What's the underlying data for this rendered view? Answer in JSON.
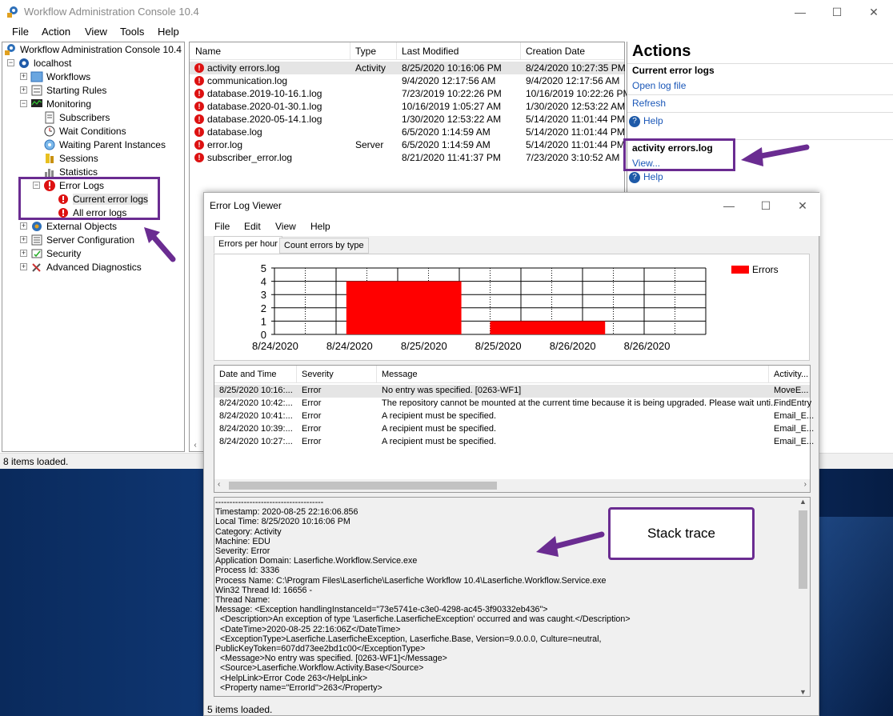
{
  "window": {
    "title": "Workflow Administration Console 10.4",
    "minimize": "—",
    "maximize": "☐",
    "close": "✕"
  },
  "menu": [
    "File",
    "Action",
    "View",
    "Tools",
    "Help"
  ],
  "tree": {
    "root": "Workflow Administration Console 10.4",
    "server": "localhost",
    "items": {
      "workflows": "Workflows",
      "starting_rules": "Starting Rules",
      "monitoring": "Monitoring",
      "subscribers": "Subscribers",
      "wait_conditions": "Wait Conditions",
      "waiting_parent": "Waiting Parent Instances",
      "sessions": "Sessions",
      "statistics": "Statistics",
      "error_logs": "Error Logs",
      "current_error_logs": "Current error logs",
      "all_error_logs": "All error logs",
      "external_objects": "External Objects",
      "server_configuration": "Server Configuration",
      "security": "Security",
      "advanced_diagnostics": "Advanced Diagnostics"
    }
  },
  "list": {
    "columns": [
      "Name",
      "Type",
      "Last Modified",
      "Creation Date"
    ],
    "rows": [
      {
        "name": "activity errors.log",
        "type": "Activity",
        "modified": "8/25/2020 10:16:06 PM",
        "created": "8/24/2020 10:27:35 PM"
      },
      {
        "name": "communication.log",
        "type": "",
        "modified": "9/4/2020 12:17:56 AM",
        "created": "9/4/2020 12:17:56 AM"
      },
      {
        "name": "database.2019-10-16.1.log",
        "type": "",
        "modified": "7/23/2019 10:22:26 PM",
        "created": "10/16/2019 10:22:26 PM"
      },
      {
        "name": "database.2020-01-30.1.log",
        "type": "",
        "modified": "10/16/2019 1:05:27 AM",
        "created": "1/30/2020 12:53:22 AM"
      },
      {
        "name": "database.2020-05-14.1.log",
        "type": "",
        "modified": "1/30/2020 12:53:22 AM",
        "created": "5/14/2020 11:01:44 PM"
      },
      {
        "name": "database.log",
        "type": "",
        "modified": "6/5/2020 1:14:59 AM",
        "created": "5/14/2020 11:01:44 PM"
      },
      {
        "name": "error.log",
        "type": "Server",
        "modified": "6/5/2020 1:14:59 AM",
        "created": "5/14/2020 11:01:44 PM"
      },
      {
        "name": "subscriber_error.log",
        "type": "",
        "modified": "8/21/2020 11:41:37 PM",
        "created": "7/23/2020 3:10:52 AM"
      }
    ]
  },
  "actions": {
    "title": "Actions",
    "section1": "Current error logs",
    "open_log": "Open log file",
    "refresh": "Refresh",
    "help": "Help",
    "section2": "activity errors.log",
    "view": "View...",
    "help2": "Help"
  },
  "status": "8 items loaded.",
  "viewer": {
    "title": "Error Log Viewer",
    "menu": [
      "File",
      "Edit",
      "View",
      "Help"
    ],
    "tabs": [
      "Errors per hour",
      "Count errors by type"
    ],
    "columns": [
      "Date and Time",
      "Severity",
      "Message",
      "Activity..."
    ],
    "rows": [
      {
        "time": "8/25/2020 10:16:...",
        "severity": "Error",
        "message": "No entry was specified. [0263-WF1]",
        "activity": "MoveE..."
      },
      {
        "time": "8/24/2020 10:42:...",
        "severity": "Error",
        "message": "The repository cannot be mounted at the current time because it is being upgraded. Please wait unti...",
        "activity": "FindEntry"
      },
      {
        "time": "8/24/2020 10:41:...",
        "severity": "Error",
        "message": "A recipient must be specified.",
        "activity": "Email_E..."
      },
      {
        "time": "8/24/2020 10:39:...",
        "severity": "Error",
        "message": "A recipient must be specified.",
        "activity": "Email_E..."
      },
      {
        "time": "8/24/2020 10:27:...",
        "severity": "Error",
        "message": "A recipient must be specified.",
        "activity": "Email_E..."
      }
    ],
    "trace": "--------------------------------------\nTimestamp: 2020-08-25 22:16:06.856\nLocal Time: 8/25/2020 10:16:06 PM\nCategory: Activity\nMachine: EDU\nSeverity: Error\nApplication Domain: Laserfiche.Workflow.Service.exe\nProcess Id: 3336\nProcess Name: C:\\Program Files\\Laserfiche\\Laserfiche Workflow 10.4\\Laserfiche.Workflow.Service.exe\nWin32 Thread Id: 16656 -\nThread Name:\nMessage: <Exception handlingInstanceId=\"73e5741e-c3e0-4298-ac45-3f90332eb436\">\n  <Description>An exception of type 'Laserfiche.LaserficheException' occurred and was caught.</Description>\n  <DateTime>2020-08-25 22:16:06Z</DateTime>\n  <ExceptionType>Laserfiche.LaserficheException, Laserfiche.Base, Version=9.0.0.0, Culture=neutral,\nPublicKeyToken=607dd73ee2bd1c00</ExceptionType>\n  <Message>No entry was specified. [0263-WF1]</Message>\n  <Source>Laserfiche.Workflow.Activity.Base</Source>\n  <HelpLink>Error Code 263</HelpLink>\n  <Property name=\"ErrorId\">263</Property>",
    "status": "5 items loaded."
  },
  "callout": "Stack trace",
  "chart_data": {
    "type": "bar",
    "categories": [
      "8/24/2020",
      "8/24/2020",
      "8/25/2020",
      "8/25/2020",
      "8/26/2020",
      "8/26/2020"
    ],
    "series": [
      {
        "name": "Errors",
        "color": "#ff0000"
      }
    ],
    "bars": [
      {
        "start": 1,
        "end": 2.6,
        "value": 4
      },
      {
        "start": 3,
        "end": 4.6,
        "value": 1
      }
    ],
    "ylim": [
      0,
      5
    ],
    "yticks": [
      "0",
      "1",
      "2",
      "3",
      "4",
      "5"
    ],
    "grid": true,
    "legend": "top-right"
  }
}
